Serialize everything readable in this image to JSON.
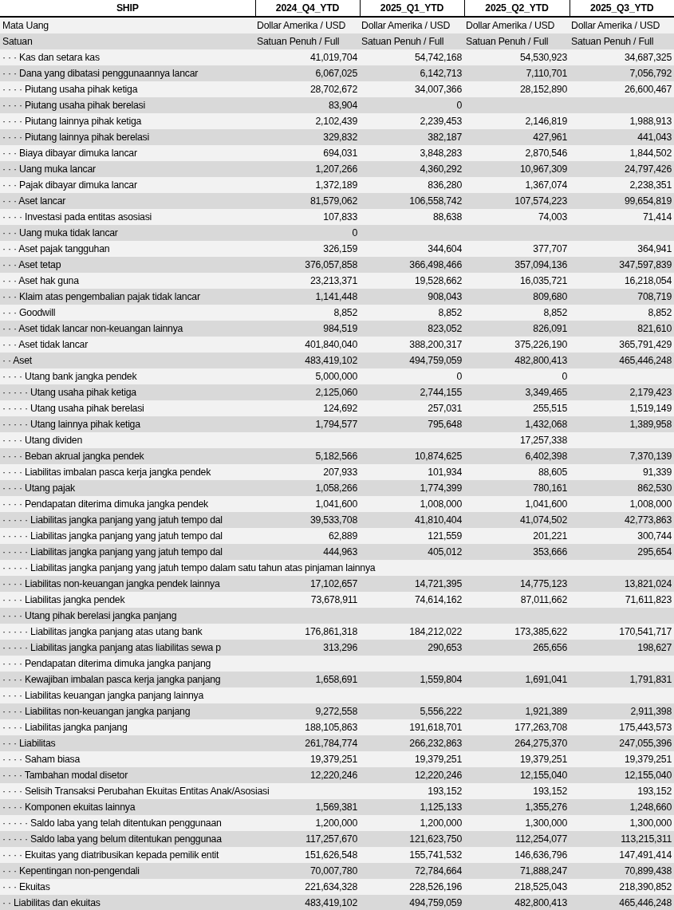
{
  "table": {
    "columns": [
      "SHIP",
      "2024_Q4_YTD",
      "2025_Q1_YTD",
      "2025_Q2_YTD",
      "2025_Q3_YTD"
    ],
    "rows": [
      {
        "kind": "text",
        "label": "Mata Uang",
        "values": {
          "q4_2024": "Dollar Amerika / USD",
          "q1_2025": "Dollar Amerika / USD",
          "q2_2025": "Dollar Amerika / USD",
          "q3_2025": "Dollar Amerika / USD"
        }
      },
      {
        "kind": "text",
        "label": "Satuan",
        "values": {
          "q4_2024": "Satuan Penuh / Full",
          "q1_2025": "Satuan Penuh / Full",
          "q2_2025": "Satuan Penuh / Full",
          "q3_2025": "Satuan Penuh / Full"
        }
      },
      {
        "kind": "number",
        "label": "· · · Kas dan setara kas",
        "values": {
          "q4_2024": "41,019,704",
          "q1_2025": "54,742,168",
          "q2_2025": "54,530,923",
          "q3_2025": "34,687,325"
        }
      },
      {
        "kind": "number",
        "label": "· · · Dana yang dibatasi penggunaannya lancar",
        "values": {
          "q4_2024": "6,067,025",
          "q1_2025": "6,142,713",
          "q2_2025": "7,110,701",
          "q3_2025": "7,056,792"
        }
      },
      {
        "kind": "number",
        "label": "· · · · Piutang usaha pihak ketiga",
        "values": {
          "q4_2024": "28,702,672",
          "q1_2025": "34,007,366",
          "q2_2025": "28,152,890",
          "q3_2025": "26,600,467"
        }
      },
      {
        "kind": "number",
        "label": "· · · · Piutang usaha pihak berelasi",
        "values": {
          "q4_2024": "83,904",
          "q1_2025": "0"
        }
      },
      {
        "kind": "number",
        "label": "· · · · Piutang lainnya pihak ketiga",
        "values": {
          "q4_2024": "2,102,439",
          "q1_2025": "2,239,453",
          "q2_2025": "2,146,819",
          "q3_2025": "1,988,913"
        }
      },
      {
        "kind": "number",
        "label": "· · · · Piutang lainnya pihak berelasi",
        "values": {
          "q4_2024": "329,832",
          "q1_2025": "382,187",
          "q2_2025": "427,961",
          "q3_2025": "441,043"
        }
      },
      {
        "kind": "number",
        "label": "· · · Biaya dibayar dimuka lancar",
        "values": {
          "q4_2024": "694,031",
          "q1_2025": "3,848,283",
          "q2_2025": "2,870,546",
          "q3_2025": "1,844,502"
        }
      },
      {
        "kind": "number",
        "label": "· · · Uang muka lancar",
        "values": {
          "q4_2024": "1,207,266",
          "q1_2025": "4,360,292",
          "q2_2025": "10,967,309",
          "q3_2025": "24,797,426"
        }
      },
      {
        "kind": "number",
        "label": "· · · Pajak dibayar dimuka lancar",
        "values": {
          "q4_2024": "1,372,189",
          "q1_2025": "836,280",
          "q2_2025": "1,367,074",
          "q3_2025": "2,238,351"
        }
      },
      {
        "kind": "number",
        "label": "· · · Aset lancar",
        "values": {
          "q4_2024": "81,579,062",
          "q1_2025": "106,558,742",
          "q2_2025": "107,574,223",
          "q3_2025": "99,654,819"
        }
      },
      {
        "kind": "number",
        "label": "· · · · Investasi pada entitas asosiasi",
        "values": {
          "q4_2024": "107,833",
          "q1_2025": "88,638",
          "q2_2025": "74,003",
          "q3_2025": "71,414"
        }
      },
      {
        "kind": "number",
        "label": "· · · Uang muka tidak lancar",
        "values": {
          "q4_2024": "0"
        }
      },
      {
        "kind": "number",
        "label": "· · · Aset pajak tangguhan",
        "values": {
          "q4_2024": "326,159",
          "q1_2025": "344,604",
          "q2_2025": "377,707",
          "q3_2025": "364,941"
        }
      },
      {
        "kind": "number",
        "label": "· · · Aset tetap",
        "values": {
          "q4_2024": "376,057,858",
          "q1_2025": "366,498,466",
          "q2_2025": "357,094,136",
          "q3_2025": "347,597,839"
        }
      },
      {
        "kind": "number",
        "label": "· · · Aset hak guna",
        "values": {
          "q4_2024": "23,213,371",
          "q1_2025": "19,528,662",
          "q2_2025": "16,035,721",
          "q3_2025": "16,218,054"
        }
      },
      {
        "kind": "number",
        "label": "· · · Klaim atas pengembalian pajak tidak lancar",
        "values": {
          "q4_2024": "1,141,448",
          "q1_2025": "908,043",
          "q2_2025": "809,680",
          "q3_2025": "708,719"
        }
      },
      {
        "kind": "number",
        "label": "· · · Goodwill",
        "values": {
          "q4_2024": "8,852",
          "q1_2025": "8,852",
          "q2_2025": "8,852",
          "q3_2025": "8,852"
        }
      },
      {
        "kind": "number",
        "label": "· · · Aset tidak lancar non-keuangan lainnya",
        "values": {
          "q4_2024": "984,519",
          "q1_2025": "823,052",
          "q2_2025": "826,091",
          "q3_2025": "821,610"
        }
      },
      {
        "kind": "number",
        "label": "· · · Aset tidak lancar",
        "values": {
          "q4_2024": "401,840,040",
          "q1_2025": "388,200,317",
          "q2_2025": "375,226,190",
          "q3_2025": "365,791,429"
        }
      },
      {
        "kind": "number",
        "label": "· · Aset",
        "values": {
          "q4_2024": "483,419,102",
          "q1_2025": "494,759,059",
          "q2_2025": "482,800,413",
          "q3_2025": "465,446,248"
        }
      },
      {
        "kind": "number",
        "label": "· · · · Utang bank jangka pendek",
        "values": {
          "q4_2024": "5,000,000",
          "q1_2025": "0",
          "q2_2025": "0"
        }
      },
      {
        "kind": "number",
        "label": "· · · · · Utang usaha pihak ketiga",
        "values": {
          "q4_2024": "2,125,060",
          "q1_2025": "2,744,155",
          "q2_2025": "3,349,465",
          "q3_2025": "2,179,423"
        }
      },
      {
        "kind": "number",
        "label": "· · · · · Utang usaha pihak berelasi",
        "values": {
          "q4_2024": "124,692",
          "q1_2025": "257,031",
          "q2_2025": "255,515",
          "q3_2025": "1,519,149"
        }
      },
      {
        "kind": "number",
        "label": "· · · · · Utang lainnya pihak ketiga",
        "values": {
          "q4_2024": "1,794,577",
          "q1_2025": "795,648",
          "q2_2025": "1,432,068",
          "q3_2025": "1,389,958"
        }
      },
      {
        "kind": "number",
        "label": "· · · · Utang dividen",
        "values": {
          "q2_2025": "17,257,338"
        }
      },
      {
        "kind": "number",
        "label": "· · · · Beban akrual jangka pendek",
        "values": {
          "q4_2024": "5,182,566",
          "q1_2025": "10,874,625",
          "q2_2025": "6,402,398",
          "q3_2025": "7,370,139"
        }
      },
      {
        "kind": "number",
        "label": "· · · · Liabilitas imbalan pasca kerja jangka pendek",
        "values": {
          "q4_2024": "207,933",
          "q1_2025": "101,934",
          "q2_2025": "88,605",
          "q3_2025": "91,339"
        }
      },
      {
        "kind": "number",
        "label": "· · · · Utang pajak",
        "values": {
          "q4_2024": "1,058,266",
          "q1_2025": "1,774,399",
          "q2_2025": "780,161",
          "q3_2025": "862,530"
        }
      },
      {
        "kind": "number",
        "label": "· · · · Pendapatan diterima dimuka jangka pendek",
        "values": {
          "q4_2024": "1,041,600",
          "q1_2025": "1,008,000",
          "q2_2025": "1,041,600",
          "q3_2025": "1,008,000"
        }
      },
      {
        "kind": "number",
        "label": "· · · · · Liabilitas jangka panjang yang jatuh tempo dal",
        "values": {
          "q4_2024": "39,533,708",
          "q1_2025": "41,810,404",
          "q2_2025": "41,074,502",
          "q3_2025": "42,773,863"
        }
      },
      {
        "kind": "number",
        "label": "· · · · · Liabilitas jangka panjang yang jatuh tempo dal",
        "values": {
          "q4_2024": "62,889",
          "q1_2025": "121,559",
          "q2_2025": "201,221",
          "q3_2025": "300,744"
        }
      },
      {
        "kind": "number",
        "label": "· · · · · Liabilitas jangka panjang yang jatuh tempo dal",
        "values": {
          "q4_2024": "444,963",
          "q1_2025": "405,012",
          "q2_2025": "353,666",
          "q3_2025": "295,654"
        }
      },
      {
        "kind": "number",
        "label": "· · · · · Liabilitas jangka panjang yang jatuh tempo dalam satu tahun atas pinjaman lainnya"
      },
      {
        "kind": "number",
        "label": "· · · · Liabilitas non-keuangan jangka pendek lainnya",
        "values": {
          "q4_2024": "17,102,657",
          "q1_2025": "14,721,395",
          "q2_2025": "14,775,123",
          "q3_2025": "13,821,024"
        }
      },
      {
        "kind": "number",
        "label": "· · · · Liabilitas jangka pendek",
        "values": {
          "q4_2024": "73,678,911",
          "q1_2025": "74,614,162",
          "q2_2025": "87,011,662",
          "q3_2025": "71,611,823"
        }
      },
      {
        "kind": "number",
        "label": "· · · · Utang pihak berelasi jangka panjang"
      },
      {
        "kind": "number",
        "label": "· · · · · Liabilitas jangka panjang atas utang bank",
        "values": {
          "q4_2024": "176,861,318",
          "q1_2025": "184,212,022",
          "q2_2025": "173,385,622",
          "q3_2025": "170,541,717"
        }
      },
      {
        "kind": "number",
        "label": "· · · · · Liabilitas jangka panjang atas liabilitas sewa p",
        "values": {
          "q4_2024": "313,296",
          "q1_2025": "290,653",
          "q2_2025": "265,656",
          "q3_2025": "198,627"
        }
      },
      {
        "kind": "number",
        "label": "· · · · Pendapatan diterima dimuka jangka panjang"
      },
      {
        "kind": "number",
        "label": "· · · · Kewajiban imbalan pasca kerja jangka panjang",
        "values": {
          "q4_2024": "1,658,691",
          "q1_2025": "1,559,804",
          "q2_2025": "1,691,041",
          "q3_2025": "1,791,831"
        }
      },
      {
        "kind": "number",
        "label": "· · · · Liabilitas keuangan jangka panjang lainnya"
      },
      {
        "kind": "number",
        "label": "· · · · Liabilitas non-keuangan jangka panjang",
        "values": {
          "q4_2024": "9,272,558",
          "q1_2025": "5,556,222",
          "q2_2025": "1,921,389",
          "q3_2025": "2,911,398"
        }
      },
      {
        "kind": "number",
        "label": "· · · · Liabilitas jangka panjang",
        "values": {
          "q4_2024": "188,105,863",
          "q1_2025": "191,618,701",
          "q2_2025": "177,263,708",
          "q3_2025": "175,443,573"
        }
      },
      {
        "kind": "number",
        "label": "· · · Liabilitas",
        "values": {
          "q4_2024": "261,784,774",
          "q1_2025": "266,232,863",
          "q2_2025": "264,275,370",
          "q3_2025": "247,055,396"
        }
      },
      {
        "kind": "number",
        "label": "· · · · Saham biasa",
        "values": {
          "q4_2024": "19,379,251",
          "q1_2025": "19,379,251",
          "q2_2025": "19,379,251",
          "q3_2025": "19,379,251"
        }
      },
      {
        "kind": "number",
        "label": "· · · · Tambahan modal disetor",
        "values": {
          "q4_2024": "12,220,246",
          "q1_2025": "12,220,246",
          "q2_2025": "12,155,040",
          "q3_2025": "12,155,040"
        }
      },
      {
        "kind": "number",
        "label": "· · · · Selisih Transaksi Perubahan Ekuitas Entitas Anak/Asosiasi",
        "values": {
          "q1_2025": "193,152",
          "q2_2025": "193,152",
          "q3_2025": "193,152"
        }
      },
      {
        "kind": "number",
        "label": "· · · · Komponen ekuitas lainnya",
        "values": {
          "q4_2024": "1,569,381",
          "q1_2025": "1,125,133",
          "q2_2025": "1,355,276",
          "q3_2025": "1,248,660"
        }
      },
      {
        "kind": "number",
        "label": "· · · · · Saldo laba yang telah ditentukan penggunaan",
        "values": {
          "q4_2024": "1,200,000",
          "q1_2025": "1,200,000",
          "q2_2025": "1,300,000",
          "q3_2025": "1,300,000"
        }
      },
      {
        "kind": "number",
        "label": "· · · · · Saldo laba yang belum ditentukan penggunaa",
        "values": {
          "q4_2024": "117,257,670",
          "q1_2025": "121,623,750",
          "q2_2025": "112,254,077",
          "q3_2025": "113,215,311"
        }
      },
      {
        "kind": "number",
        "label": "· · · · Ekuitas yang diatribusikan kepada pemilik entit",
        "values": {
          "q4_2024": "151,626,548",
          "q1_2025": "155,741,532",
          "q2_2025": "146,636,796",
          "q3_2025": "147,491,414"
        }
      },
      {
        "kind": "number",
        "label": "· · · Kepentingan non-pengendali",
        "values": {
          "q4_2024": "70,007,780",
          "q1_2025": "72,784,664",
          "q2_2025": "71,888,247",
          "q3_2025": "70,899,438"
        }
      },
      {
        "kind": "number",
        "label": "· · · Ekuitas",
        "values": {
          "q4_2024": "221,634,328",
          "q1_2025": "228,526,196",
          "q2_2025": "218,525,043",
          "q3_2025": "218,390,852"
        }
      },
      {
        "kind": "number",
        "label": "· · Liabilitas dan ekuitas",
        "values": {
          "q4_2024": "483,419,102",
          "q1_2025": "494,759,059",
          "q2_2025": "482,800,413",
          "q3_2025": "465,446,248"
        }
      }
    ]
  }
}
